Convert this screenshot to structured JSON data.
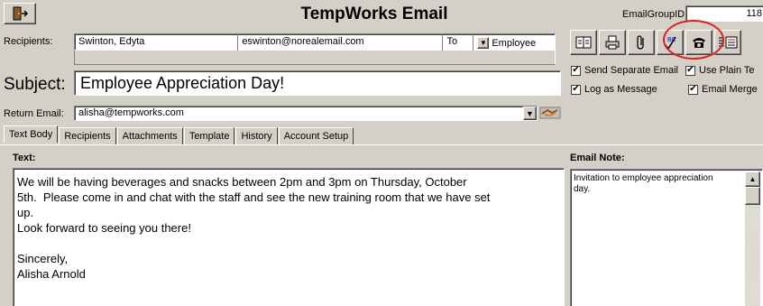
{
  "window": {
    "title": "TempWorks Email",
    "group_id_label": "EmailGroupID",
    "group_id_value": "118"
  },
  "recipients": {
    "label": "Recipients:",
    "rows": [
      {
        "name": "Swinton, Edyta",
        "email": "eswinton@norealemail.com",
        "type": "To",
        "kind": "Employee"
      }
    ]
  },
  "subject": {
    "label": "Subject:",
    "value": "Employee Appreciation Day!"
  },
  "return_email": {
    "label": "Return Email:",
    "value": "alisha@tempworks.com"
  },
  "tabs": [
    {
      "label": "Text Body",
      "active": true
    },
    {
      "label": "Recipients",
      "active": false
    },
    {
      "label": "Attachments",
      "active": false
    },
    {
      "label": "Template",
      "active": false
    },
    {
      "label": "History",
      "active": false
    },
    {
      "label": "Account Setup",
      "active": false
    }
  ],
  "toolbar": {
    "icons": [
      "address-book-icon",
      "print-icon",
      "attachment-icon",
      "spell-check-icon",
      "phone-icon",
      "merge-fields-icon"
    ],
    "highlight_color": "#e0201c"
  },
  "options": {
    "send_separate": {
      "label": "Send Separate Email",
      "checked": true
    },
    "use_plain_text": {
      "label": "Use Plain Te",
      "checked": true
    },
    "log_as_message": {
      "label": "Log as Message",
      "checked": true
    },
    "email_merge": {
      "label": "Email Merge",
      "checked": true
    }
  },
  "text_body": {
    "label": "Text:",
    "lines": [
      "We will be having beverages and snacks between 2pm and 3pm on Thursday, October",
      "5th.  Please come in and chat with the staff and see the new training room that we have set",
      "up.",
      "Look forward to seeing you there!",
      "",
      "Sincerely,",
      "Alisha Arnold"
    ]
  },
  "email_note": {
    "label": "Email Note:",
    "lines": [
      "Invitation to employee appreciation",
      "day."
    ]
  }
}
